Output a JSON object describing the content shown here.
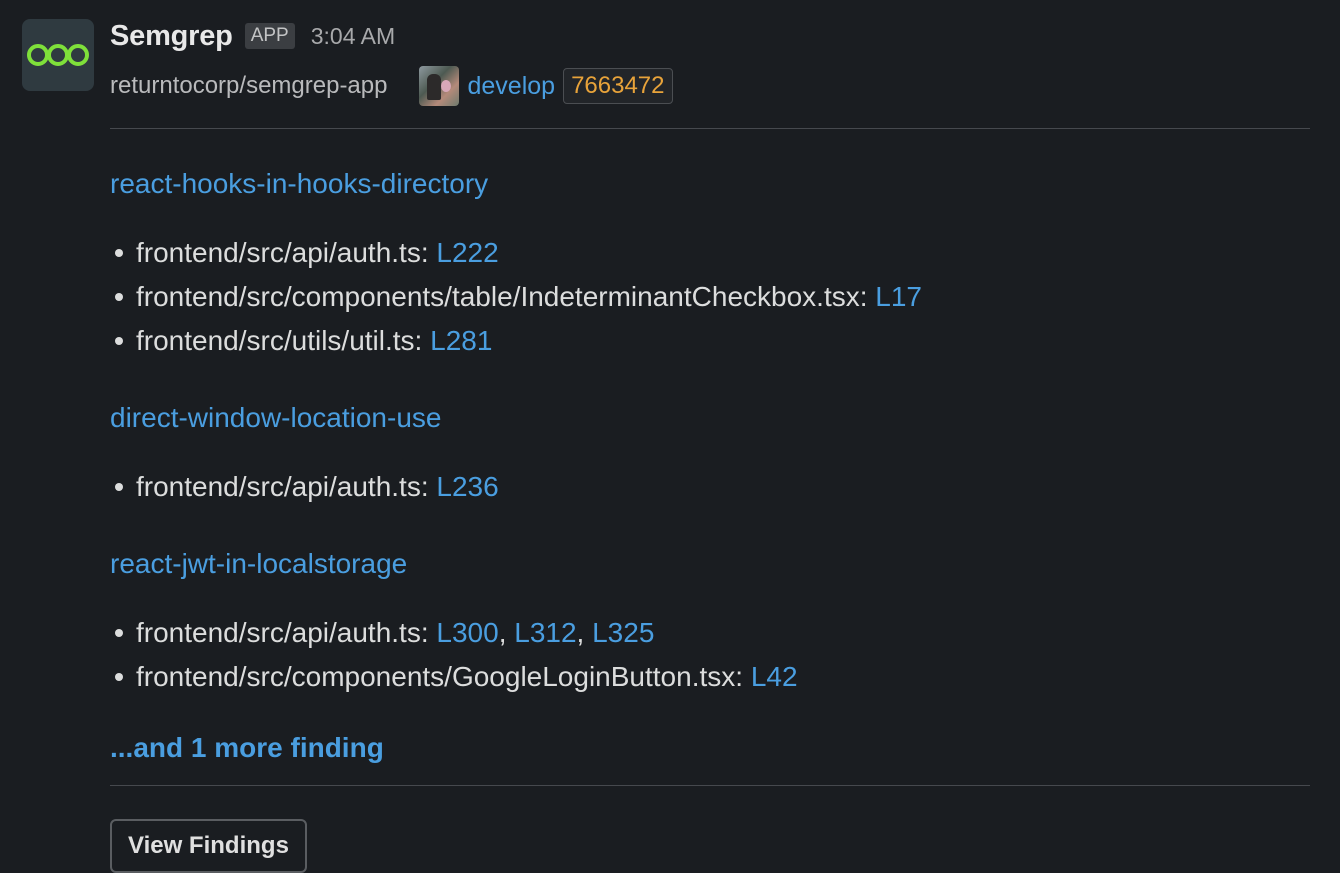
{
  "message": {
    "sender": "Semgrep",
    "app_badge": "APP",
    "time": "3:04 AM",
    "repo": "returntocorp/semgrep-app",
    "branch": "develop",
    "commit_sha": "7663472",
    "brand_color": "#7fe03a",
    "link_color": "#4a9ee0"
  },
  "groups": [
    {
      "rule": "react-hooks-in-hooks-directory",
      "findings": [
        {
          "path": "frontend/src/api/auth.ts:",
          "lines": [
            "L222"
          ]
        },
        {
          "path": "frontend/src/components/table/IndeterminantCheckbox.tsx:",
          "lines": [
            "L17"
          ]
        },
        {
          "path": "frontend/src/utils/util.ts:",
          "lines": [
            "L281"
          ]
        }
      ]
    },
    {
      "rule": "direct-window-location-use",
      "findings": [
        {
          "path": "frontend/src/api/auth.ts:",
          "lines": [
            "L236"
          ]
        }
      ]
    },
    {
      "rule": "react-jwt-in-localstorage",
      "findings": [
        {
          "path": "frontend/src/api/auth.ts:",
          "lines": [
            "L300",
            "L312",
            "L325"
          ]
        },
        {
          "path": "frontend/src/components/GoogleLoginButton.tsx:",
          "lines": [
            "L42"
          ]
        }
      ]
    }
  ],
  "more_text": "...and 1 more finding",
  "view_button": "View Findings",
  "separator": ", "
}
